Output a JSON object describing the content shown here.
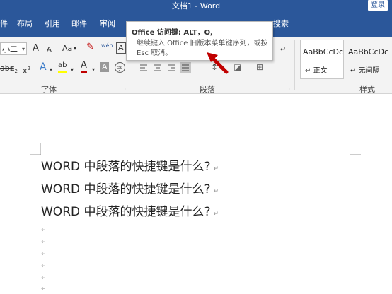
{
  "window": {
    "title": "文档1  -  Word",
    "signin": "登录"
  },
  "tabs": [
    {
      "label": "件"
    },
    {
      "label": "布局"
    },
    {
      "label": "引用"
    },
    {
      "label": "邮件"
    },
    {
      "label": "审阅"
    },
    {
      "label": "搜索"
    }
  ],
  "ribbon": {
    "font_size": "小二",
    "grow_font": "A",
    "shrink_font": "A",
    "change_case": "Aa",
    "pinyin": "wén",
    "char_border": "A",
    "strike": "abc",
    "subscript": "x",
    "superscript": "x",
    "text_effect": "A",
    "highlight": "ab",
    "font_color": "A",
    "char_shading": "A",
    "enclose": "字",
    "group_font": "字体",
    "group_paragraph": "段落",
    "group_styles": "样式",
    "styles": [
      {
        "sample": "AaBbCcDc",
        "name": "正文"
      },
      {
        "sample": "AaBbCcDc",
        "name": "无间隔"
      }
    ]
  },
  "tooltip": {
    "title": "Office 访问键: ALT，O,",
    "body": "继续键入 Office 旧版本菜单键序列，或按 Esc 取消。"
  },
  "document": {
    "lines": [
      "WORD 中段落的快捷键是什么?",
      "WORD 中段落的快捷键是什么?",
      "WORD 中段落的快捷键是什么?"
    ],
    "paragraph_mark": "↵",
    "empty_paragraph_marks": [
      "↵",
      "↵",
      "↵",
      "↵",
      "↵",
      "↵"
    ]
  },
  "colors": {
    "title_blue": "#2b579a",
    "arrow_red": "#c00000"
  }
}
